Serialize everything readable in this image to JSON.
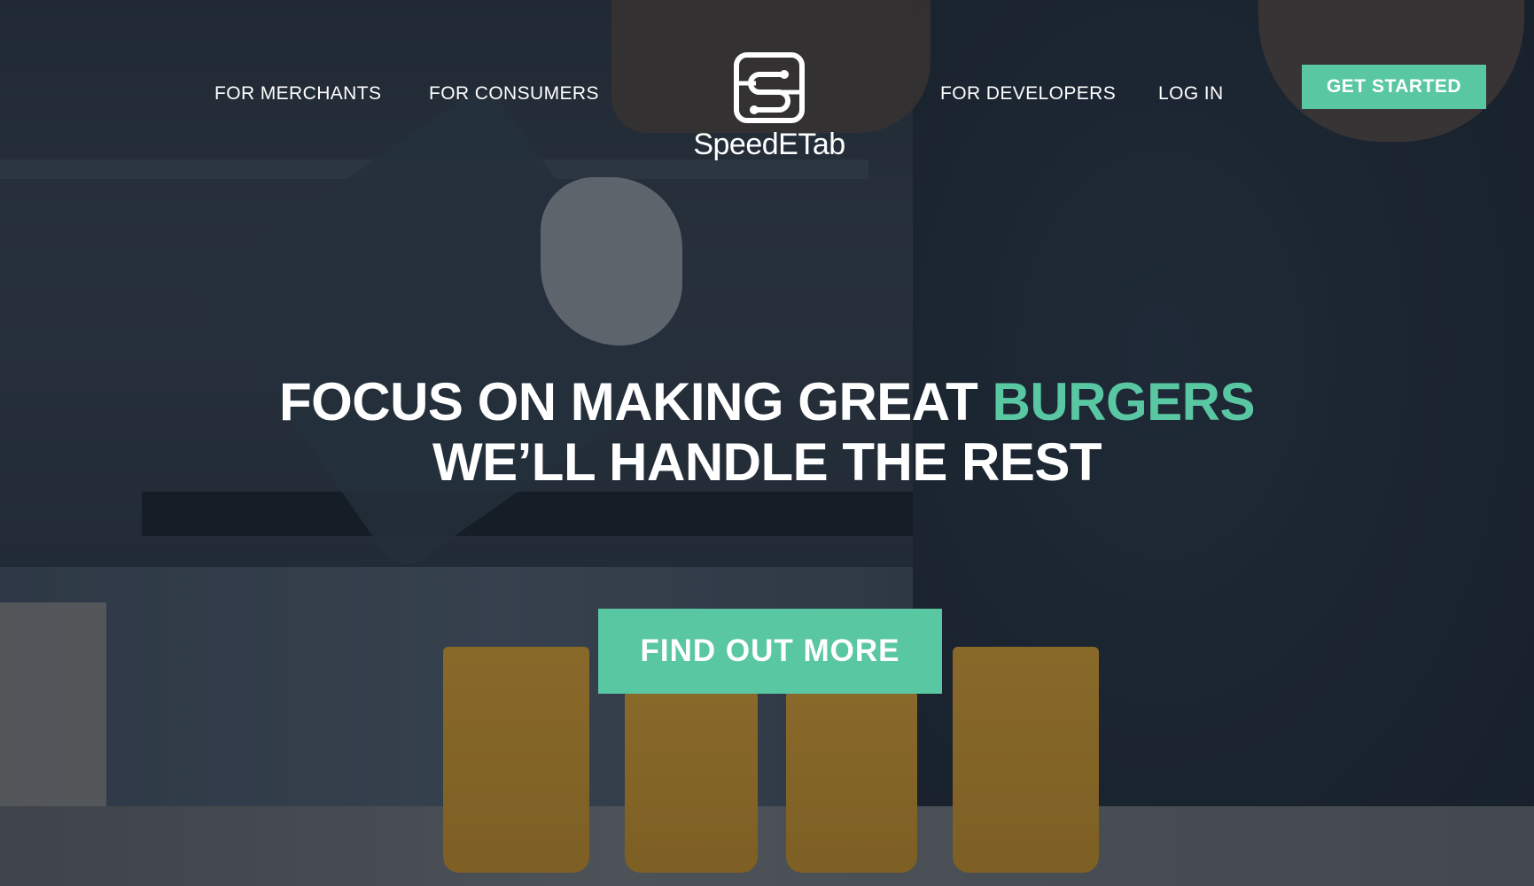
{
  "nav": {
    "left_links": [
      {
        "label": "FOR MERCHANTS"
      },
      {
        "label": "FOR CONSUMERS"
      }
    ],
    "right_links": [
      {
        "label": "FOR DEVELOPERS"
      },
      {
        "label": "LOG IN"
      }
    ],
    "cta_label": "GET STARTED"
  },
  "logo": {
    "wordmark": "SpeedETab",
    "icon": "speedetab-logo-icon"
  },
  "hero": {
    "headline_line1_prefix": "FOCUS ON MAKING GREAT",
    "headline_line1_accent": "BURGERS",
    "headline_line2": "WE’LL HANDLE THE REST",
    "cta_label": "FIND OUT MORE"
  },
  "colors": {
    "accent": "#5ac7a3",
    "text": "#ffffff",
    "overlay": "#1e2833"
  }
}
